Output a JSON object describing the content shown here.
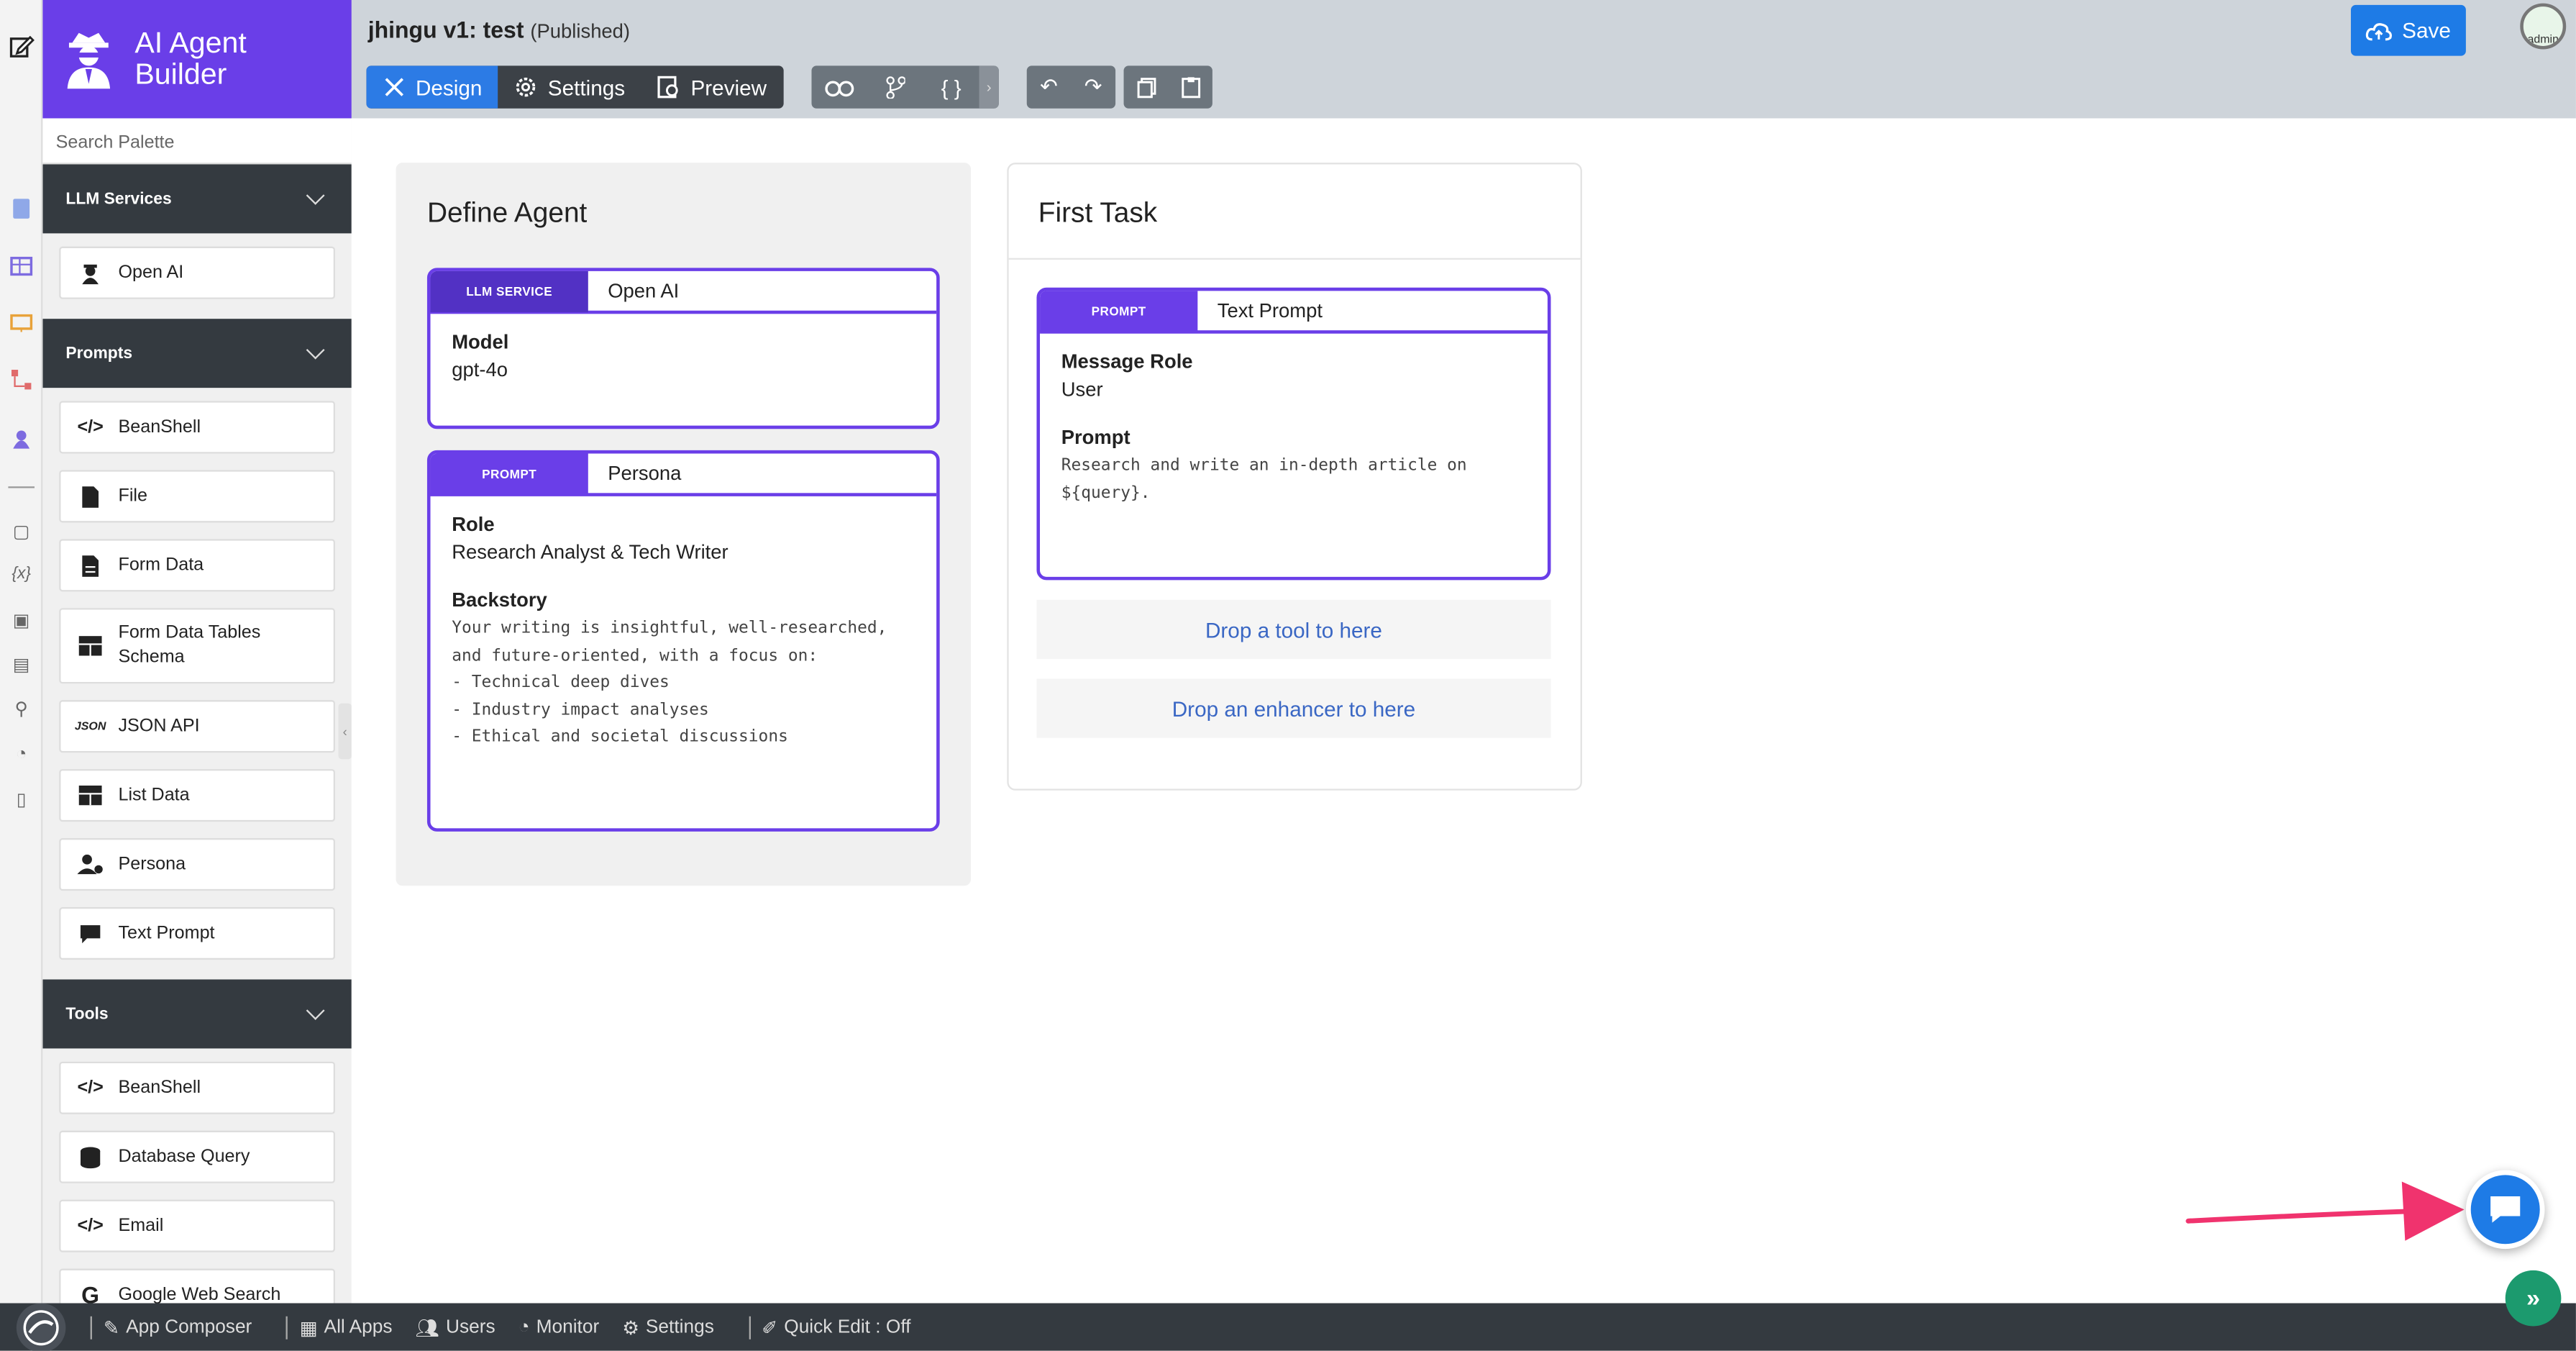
{
  "brand": {
    "title": "AI Agent Builder"
  },
  "app": {
    "title": "jhingu v1: test",
    "status": "(Published)"
  },
  "modes": [
    {
      "label": "Design",
      "icon": "design-tools-icon",
      "active": true
    },
    {
      "label": "Settings",
      "icon": "gear-icon",
      "active": false
    },
    {
      "label": "Preview",
      "icon": "preview-icon",
      "active": false
    }
  ],
  "toolbar": {
    "save_label": "Save",
    "avatar_text": "admin"
  },
  "palette": {
    "search_placeholder": "Search Palette",
    "sections": [
      {
        "title": "LLM Services",
        "items": [
          {
            "label": "Open AI",
            "icon": "agent-icon"
          }
        ]
      },
      {
        "title": "Prompts",
        "items": [
          {
            "label": "BeanShell",
            "icon": "code-icon"
          },
          {
            "label": "File",
            "icon": "file-icon"
          },
          {
            "label": "Form Data",
            "icon": "form-icon"
          },
          {
            "label": "Form Data Tables Schema",
            "icon": "table-icon"
          },
          {
            "label": "JSON API",
            "icon": "json-icon",
            "icon_text": "JSON"
          },
          {
            "label": "List Data",
            "icon": "table-icon"
          },
          {
            "label": "Persona",
            "icon": "persona-icon"
          },
          {
            "label": "Text Prompt",
            "icon": "comment-icon"
          }
        ]
      },
      {
        "title": "Tools",
        "items": [
          {
            "label": "BeanShell",
            "icon": "code-icon"
          },
          {
            "label": "Database Query",
            "icon": "database-icon"
          },
          {
            "label": "Email",
            "icon": "code-icon"
          },
          {
            "label": "Google Web Search",
            "icon": "google-icon",
            "icon_text": "G"
          }
        ]
      }
    ]
  },
  "define_agent": {
    "title": "Define Agent",
    "llm_card": {
      "tag": "LLM SERVICE",
      "name": "Open AI",
      "model_label": "Model",
      "model_value": "gpt-4o"
    },
    "persona_card": {
      "tag": "PROMPT",
      "name": "Persona",
      "role_label": "Role",
      "role_value": "Research Analyst & Tech Writer",
      "backstory_label": "Backstory",
      "backstory_value": "Your writing is insightful, well-researched, and future-oriented, with a focus on:\n- Technical deep dives\n- Industry impact analyses\n- Ethical and societal discussions"
    }
  },
  "first_task": {
    "title": "First Task",
    "prompt_card": {
      "tag": "PROMPT",
      "name": "Text Prompt",
      "role_label": "Message Role",
      "role_value": "User",
      "prompt_label": "Prompt",
      "prompt_value": "Research and write an in-depth article on ${query}."
    },
    "drop_tool": "Drop a tool to here",
    "drop_enhancer": "Drop an enhancer to here"
  },
  "bottombar": {
    "items": [
      {
        "label": "App Composer",
        "icon": "edit-icon"
      },
      {
        "label": "All Apps",
        "icon": "grid-icon"
      },
      {
        "label": "Users",
        "icon": "users-icon"
      },
      {
        "label": "Monitor",
        "icon": "gauge-icon"
      },
      {
        "label": "Settings",
        "icon": "gears-icon"
      },
      {
        "label": "Quick Edit : Off",
        "icon": "pencil-icon"
      }
    ]
  },
  "colors": {
    "accent": "#6a3ee8",
    "primary": "#1e7be6",
    "dark": "#343a40",
    "arrow": "#f0336e"
  }
}
